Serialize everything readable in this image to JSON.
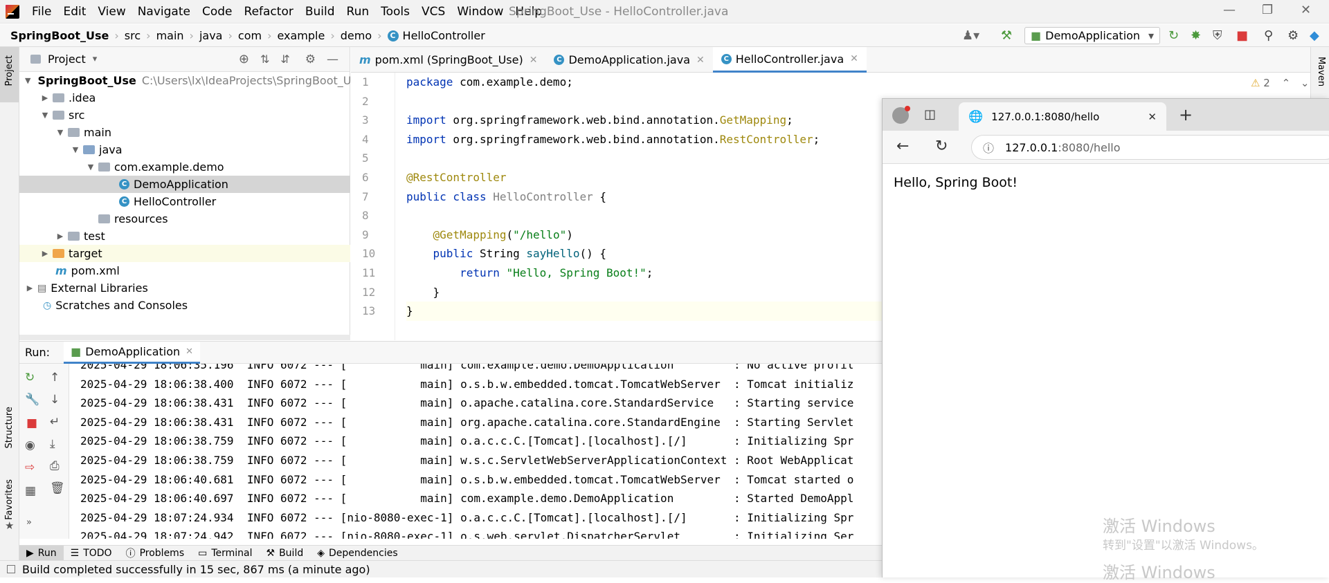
{
  "window": {
    "title": "SpringBoot_Use - HelloController.java",
    "menu": [
      "File",
      "Edit",
      "View",
      "Navigate",
      "Code",
      "Refactor",
      "Build",
      "Run",
      "Tools",
      "VCS",
      "Window",
      "Help"
    ]
  },
  "breadcrumbs": [
    "SpringBoot_Use",
    "src",
    "main",
    "java",
    "com",
    "example",
    "demo",
    "HelloController"
  ],
  "toolbar": {
    "run_config": "DemoApplication"
  },
  "project": {
    "header": "Project",
    "tree": [
      {
        "label": "SpringBoot_Use",
        "path": "C:\\Users\\lx\\IdeaProjects\\SpringBoot_Use"
      },
      {
        "label": ".idea"
      },
      {
        "label": "src"
      },
      {
        "label": "main"
      },
      {
        "label": "java"
      },
      {
        "label": "com.example.demo"
      },
      {
        "label": "DemoApplication"
      },
      {
        "label": "HelloController"
      },
      {
        "label": "resources"
      },
      {
        "label": "test"
      },
      {
        "label": "target"
      },
      {
        "label": "pom.xml"
      },
      {
        "label": "External Libraries"
      },
      {
        "label": "Scratches and Consoles"
      }
    ]
  },
  "editor": {
    "tabs": [
      "pom.xml (SpringBoot_Use)",
      "DemoApplication.java",
      "HelloController.java"
    ],
    "active_tab": "HelloController.java",
    "warnings": "2",
    "line_numbers": [
      "1",
      "2",
      "3",
      "4",
      "5",
      "6",
      "7",
      "8",
      "9",
      "10",
      "11",
      "12",
      "13"
    ],
    "code": {
      "l1_kw": "package",
      "l1_rest": " com.example.demo;",
      "l3_kw": "import",
      "l3_pkg": " org.springframework.web.bind.annotation.",
      "l3_cls": "GetMapping",
      "l3_end": ";",
      "l4_kw": "import",
      "l4_pkg": " org.springframework.web.bind.annotation.",
      "l4_cls": "RestController",
      "l4_end": ";",
      "l6": "@RestController",
      "l7_kw": "public class",
      "l7_name": " HelloController",
      "l7_end": " {",
      "l9_ann": "    @GetMapping",
      "l9_paren": "(",
      "l9_str": "\"/hello\"",
      "l9_end": ")",
      "l10_kw": "    public",
      "l10_type": " String ",
      "l10_fn": "sayHello",
      "l10_end": "() {",
      "l11_kw": "        return",
      "l11_sp": " ",
      "l11_str": "\"Hello, Spring Boot!\"",
      "l11_end": ";",
      "l12": "    }",
      "l13": "}"
    }
  },
  "run": {
    "label": "Run:",
    "tab": "DemoApplication",
    "log": [
      "2025-04-29 18:06:35.196  INFO 6072 --- [           main] com.example.demo.DemoApplication         : No active profil",
      "2025-04-29 18:06:38.400  INFO 6072 --- [           main] o.s.b.w.embedded.tomcat.TomcatWebServer  : Tomcat initializ",
      "2025-04-29 18:06:38.431  INFO 6072 --- [           main] o.apache.catalina.core.StandardService   : Starting service",
      "2025-04-29 18:06:38.431  INFO 6072 --- [           main] org.apache.catalina.core.StandardEngine  : Starting Servlet",
      "2025-04-29 18:06:38.759  INFO 6072 --- [           main] o.a.c.c.C.[Tomcat].[localhost].[/]       : Initializing Spr",
      "2025-04-29 18:06:38.759  INFO 6072 --- [           main] w.s.c.ServletWebServerApplicationContext : Root WebApplicat",
      "2025-04-29 18:06:40.681  INFO 6072 --- [           main] o.s.b.w.embedded.tomcat.TomcatWebServer  : Tomcat started o",
      "2025-04-29 18:06:40.697  INFO 6072 --- [           main] com.example.demo.DemoApplication         : Started DemoAppl",
      "2025-04-29 18:07:24.934  INFO 6072 --- [nio-8080-exec-1] o.a.c.c.C.[Tomcat].[localhost].[/]       : Initializing Spr",
      "2025-04-29 18:07:24.942  INFO 6072 --- [nio-8080-exec-1] o.s.web.servlet.DispatcherServlet        : Initializing Ser"
    ]
  },
  "left_stripe": {
    "project": "Project",
    "structure": "Structure",
    "favorites": "Favorites"
  },
  "right_stripe": {
    "maven": "Maven"
  },
  "bottom_tabs": [
    "Run",
    "TODO",
    "Problems",
    "Terminal",
    "Build",
    "Dependencies"
  ],
  "status": "Build completed successfully in 15 sec, 867 ms (a minute ago)",
  "browser": {
    "tab_title": "127.0.0.1:8080/hello",
    "url_host": "127.0.0.1",
    "url_rest": ":8080/hello",
    "content": "Hello, Spring Boot!"
  },
  "watermark": {
    "line1": "激活 Windows",
    "line2": "转到\"设置\"以激活 Windows。",
    "line3": "激活 Windows"
  }
}
